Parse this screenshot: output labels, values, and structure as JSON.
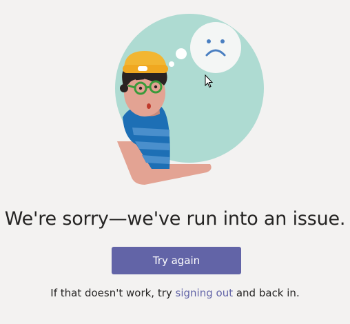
{
  "error": {
    "headline": "We're sorry—we've run into an issue.",
    "primary_action_label": "Try again",
    "help_prefix": "If that doesn't work, try ",
    "help_link_label": "signing out",
    "help_suffix": " and back in."
  },
  "icons": {
    "illustration": "confused-person-illustration",
    "thought_bubble": "sad-face-icon",
    "cursor": "mouse-pointer-icon"
  },
  "colors": {
    "background": "#f3f2f1",
    "circle": "#aedbd2",
    "accent": "#6264a7",
    "text": "#252423",
    "hat": "#f2b632",
    "shirt": "#1d6fb5",
    "glasses": "#3a9a3a"
  }
}
